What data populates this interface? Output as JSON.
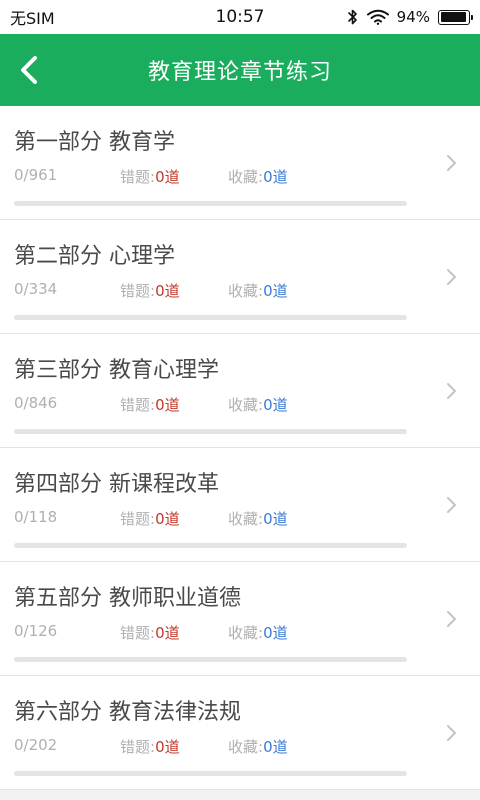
{
  "status_bar": {
    "carrier": "无SIM",
    "time": "10:57",
    "battery_percent_text": "94%",
    "battery_level": 0.94
  },
  "header": {
    "title": "教育理论章节练习",
    "back_icon": "chevron-left-icon",
    "color": "#1aad5e"
  },
  "colors": {
    "wrong_value": "#c0392b",
    "fav_value": "#3a7bd5"
  },
  "labels": {
    "wrong": "错题:",
    "fav": "收藏:"
  },
  "chapters": [
    {
      "title": "第一部分 教育学",
      "progress": "0/961",
      "wrong": "0道",
      "fav": "0道",
      "completion": 0
    },
    {
      "title": "第二部分 心理学",
      "progress": "0/334",
      "wrong": "0道",
      "fav": "0道",
      "completion": 0
    },
    {
      "title": "第三部分 教育心理学",
      "progress": "0/846",
      "wrong": "0道",
      "fav": "0道",
      "completion": 0
    },
    {
      "title": "第四部分 新课程改革",
      "progress": "0/118",
      "wrong": "0道",
      "fav": "0道",
      "completion": 0
    },
    {
      "title": "第五部分 教师职业道德",
      "progress": "0/126",
      "wrong": "0道",
      "fav": "0道",
      "completion": 0
    },
    {
      "title": "第六部分 教育法律法规",
      "progress": "0/202",
      "wrong": "0道",
      "fav": "0道",
      "completion": 0
    }
  ]
}
